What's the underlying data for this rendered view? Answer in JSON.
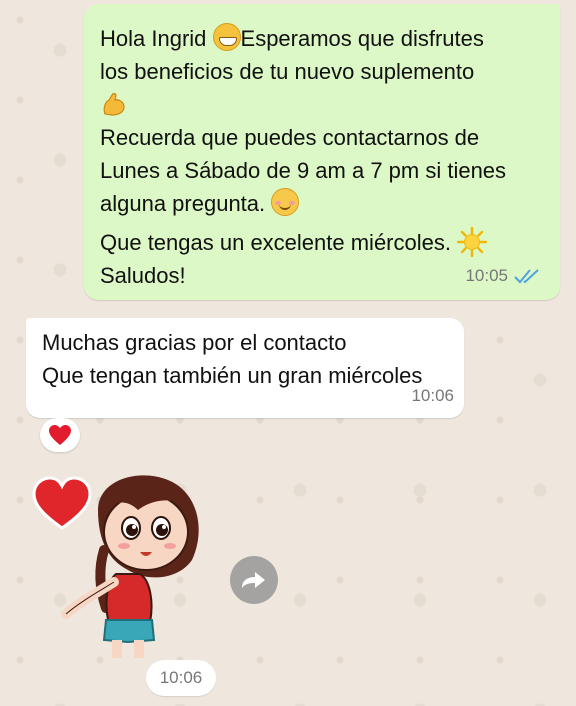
{
  "chat": {
    "outgoing": {
      "line1_a": "Hola Ingrid",
      "line1_b": "Esperamos que disfrutes",
      "line2": "los beneficios de tu nuevo suplemento",
      "line4": "Recuerda que puedes contactarnos de",
      "line5": "Lunes a Sábado de 9 am a 7 pm si tienes",
      "line6": "alguna pregunta.",
      "line7": "Que tengas un excelente miércoles.",
      "line8": "Saludos!",
      "time": "10:05",
      "status": "read",
      "ticks_color": "#4fa3e0",
      "bubble_color": "#dcf8c6"
    },
    "incoming": {
      "line1": "Muchas gracias por el contacto",
      "line2": "Que tengan también un gran miércoles",
      "time": "10:06",
      "reaction": "red-heart-icon"
    },
    "sticker": {
      "description_icon": "girl-with-heart-sticker",
      "time": "10:06",
      "forward_icon": "forward-icon"
    }
  }
}
